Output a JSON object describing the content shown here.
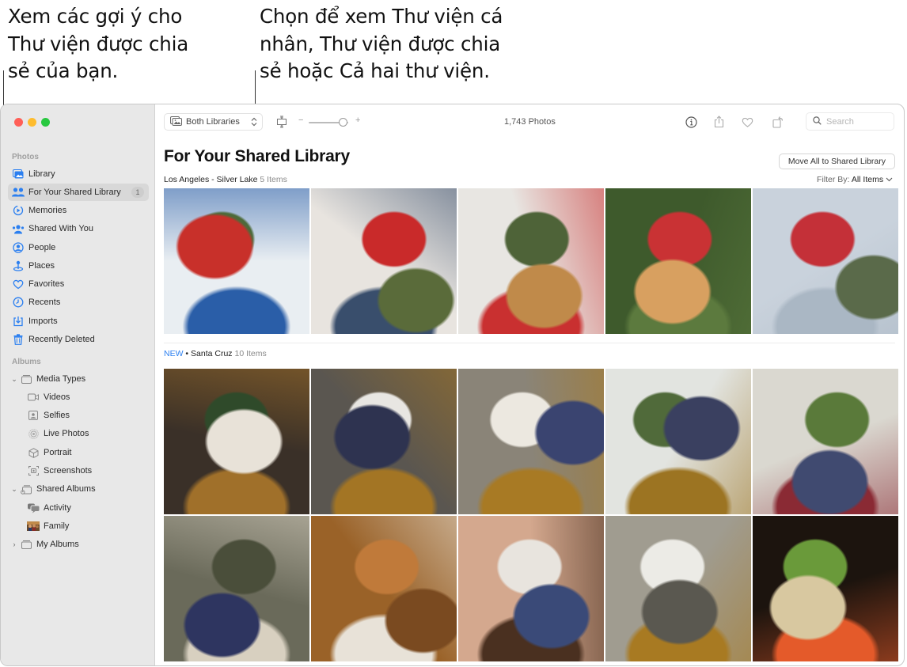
{
  "callouts": [
    {
      "text": "Xem các gợi ý cho\nThư viện được chia\nsẻ của bạn."
    },
    {
      "text": "Chọn để xem Thư viện cá\nnhân, Thư viện được chia\nsẻ hoặc Cả hai thư viện."
    }
  ],
  "window": {
    "traffic_lights": [
      "close",
      "minimize",
      "zoom"
    ]
  },
  "sidebar": {
    "sections": [
      {
        "label": "Photos"
      },
      {
        "label": "Albums"
      }
    ],
    "photos_items": [
      {
        "label": "Library",
        "icon": "photo-library-icon"
      },
      {
        "label": "For Your Shared Library",
        "icon": "people-icon",
        "badge": "1",
        "selected": true
      },
      {
        "label": "Memories",
        "icon": "memories-icon"
      },
      {
        "label": "Shared With You",
        "icon": "shared-with-you-icon"
      },
      {
        "label": "People",
        "icon": "person-circle-icon"
      },
      {
        "label": "Places",
        "icon": "map-pin-icon"
      },
      {
        "label": "Favorites",
        "icon": "heart-icon"
      },
      {
        "label": "Recents",
        "icon": "clock-icon"
      },
      {
        "label": "Imports",
        "icon": "import-icon"
      },
      {
        "label": "Recently Deleted",
        "icon": "trash-icon"
      }
    ],
    "album_items": [
      {
        "label": "Media Types",
        "icon": "folder-stack-icon",
        "expanded": true,
        "children": [
          {
            "label": "Videos",
            "icon": "video-icon"
          },
          {
            "label": "Selfies",
            "icon": "selfie-icon"
          },
          {
            "label": "Live Photos",
            "icon": "live-photo-icon"
          },
          {
            "label": "Portrait",
            "icon": "cube-icon"
          },
          {
            "label": "Screenshots",
            "icon": "screenshot-icon"
          }
        ]
      },
      {
        "label": "Shared Albums",
        "icon": "shared-album-icon",
        "expanded": true,
        "children": [
          {
            "label": "Activity",
            "icon": "speech-bubbles-icon"
          },
          {
            "label": "Family",
            "icon": "album-thumbnail-icon"
          }
        ]
      },
      {
        "label": "My Albums",
        "icon": "folder-stack-icon",
        "expanded": false
      }
    ]
  },
  "toolbar": {
    "library_selector": "Both Libraries",
    "photo_count": "1,743 Photos",
    "zoom_level": 0.85,
    "zoom_minus": "−",
    "zoom_plus": "+",
    "search_placeholder": "Search"
  },
  "main": {
    "title": "For Your Shared Library",
    "move_all_button": "Move All to Shared Library",
    "filter_label": "Filter By:",
    "filter_value": "All Items",
    "sections": [
      {
        "new_tag": "",
        "location": "Los Angeles - Silver Lake",
        "count": "5 Items",
        "photos": [
          {
            "desc": "Child behind blue window with arms raised",
            "colors": [
              "#e9eef2",
              "#2a5ea8",
              "#4d6a3a",
              "#c8302a"
            ]
          },
          {
            "desc": "Two children sitting on bed with red box",
            "colors": [
              "#e8e4df",
              "#394e6c",
              "#c92a2a",
              "#5a6b3a"
            ]
          },
          {
            "desc": "Child playing ukulele",
            "colors": [
              "#e8e6e2",
              "#c93030",
              "#4e6338",
              "#c08a4a"
            ]
          },
          {
            "desc": "Smiling child in red overalls under orange tree",
            "colors": [
              "#3e5a2c",
              "#5c7a3e",
              "#c93234",
              "#d8a060"
            ]
          },
          {
            "desc": "Child with megaphone under sky",
            "colors": [
              "#c9d2dc",
              "#aab7c4",
              "#c43038",
              "#5a6a4a"
            ]
          }
        ]
      },
      {
        "new_tag": "NEW",
        "separator": "•",
        "location": "Santa Cruz",
        "count": "10 Items",
        "photos": [
          {
            "desc": "Kitchen table baking with plants",
            "colors": [
              "#3a3028",
              "#a0702a",
              "#2f4a2a",
              "#e8e2d8"
            ]
          },
          {
            "desc": "Woman with towel and child in stripes",
            "colors": [
              "#5a5650",
              "#a37524",
              "#e8e6e2",
              "#2e3350"
            ]
          },
          {
            "desc": "Smiling woman and child",
            "colors": [
              "#8a8478",
              "#a87a24",
              "#ece8e0",
              "#3a4470"
            ]
          },
          {
            "desc": "Woman and children at window",
            "colors": [
              "#e2e4e0",
              "#9c7422",
              "#506a3a",
              "#3a4060"
            ]
          },
          {
            "desc": "Children near garden door",
            "colors": [
              "#dad8d0",
              "#8a2a34",
              "#5a7a3a",
              "#404a70"
            ]
          },
          {
            "desc": "Child eating orange",
            "colors": [
              "#6a6a5a",
              "#d8d0c0",
              "#4a4e3a",
              "#2e3560"
            ]
          },
          {
            "desc": "Flour on wooden table",
            "colors": [
              "#9a6228",
              "#e8e2d8",
              "#c07a3a",
              "#7a4a20"
            ]
          },
          {
            "desc": "Child with floury hands on face",
            "colors": [
              "#d4a88e",
              "#4a3020",
              "#e8e4de",
              "#3a4a78"
            ]
          },
          {
            "desc": "Smiling woman with towel",
            "colors": [
              "#a09c90",
              "#a87a22",
              "#ecebe6",
              "#5a5850"
            ]
          },
          {
            "desc": "Tulips and children",
            "colors": [
              "#1c140e",
              "#e45a2a",
              "#6a9a3a",
              "#d8c8a0"
            ]
          }
        ]
      }
    ]
  }
}
